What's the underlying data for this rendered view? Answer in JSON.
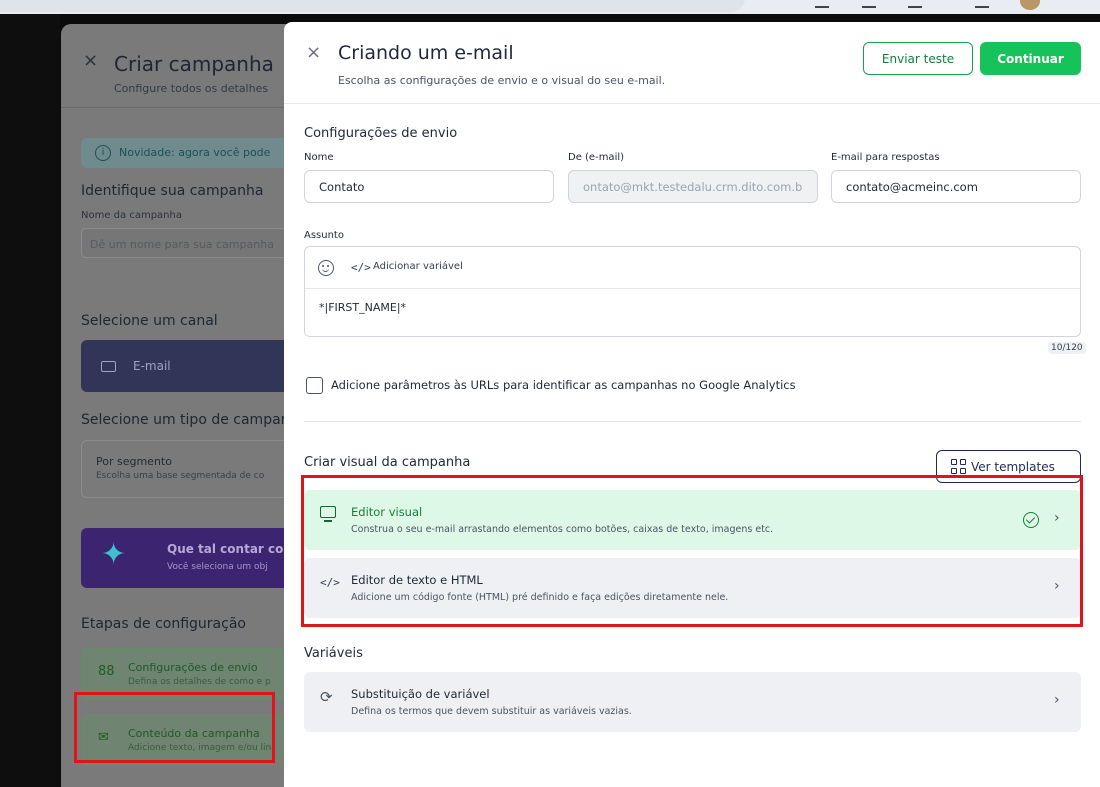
{
  "browser": {
    "url_fragment": "pag"
  },
  "background": {
    "title": "Criar campanha",
    "subtitle": "Configure todos os detalhes",
    "info_banner": "Novidade: agora você pode",
    "identify_heading": "Identifique sua campanha",
    "campaign_name_label": "Nome da campanha",
    "campaign_name_placeholder": "Dê um nome para sua campanha",
    "channel_heading": "Selecione um canal",
    "channel_email": "E-mail",
    "type_heading": "Selecione um tipo de campanha",
    "segment_title": "Por segmento",
    "segment_subtitle": "Escolha uma base segmentada de co",
    "promo_title": "Que tal contar com",
    "promo_subtitle": "Você seleciona um obj",
    "steps_heading": "Etapas de configuração",
    "step1_title": "Configurações de envio",
    "step1_subtitle": "Defina os detalhes de como e p",
    "step2_title": "Conteúdo da campanha",
    "step2_subtitle": "Adicione texto, imagem e/ou lin"
  },
  "drawer": {
    "title": "Criando um e-mail",
    "subtitle": "Escolha as configurações de envio e o visual do seu e-mail.",
    "send_test_label": "Enviar teste",
    "continue_label": "Continuar",
    "send_settings_heading": "Configurações de envio",
    "name_label": "Nome",
    "name_value": "Contato",
    "from_label": "De (e-mail)",
    "from_value": "ontato@mkt.testedalu.crm.dito.com.b",
    "reply_label": "E-mail para respostas",
    "reply_value": "contato@acmeinc.com",
    "subject_label": "Assunto",
    "add_variable_label": "Adicionar variável",
    "subject_value": "*|FIRST_NAME|*",
    "char_counter": "10/120",
    "utm_checkbox_label": "Adicione parâmetros às URLs para identificar as campanhas no Google Analytics",
    "utm_checked": false,
    "visual_heading": "Criar visual da campanha",
    "templates_label": "Ver templates",
    "editor_visual_title": "Editor visual",
    "editor_visual_subtitle": "Construa o seu e-mail arrastando elementos como botões, caixas de texto, imagens etc.",
    "editor_html_title": "Editor de texto e HTML",
    "editor_html_subtitle": "Adicione um código fonte (HTML) pré definido e faça edições diretamente nele.",
    "variables_heading": "Variáveis",
    "var_sub_title": "Substituição de variável",
    "var_sub_subtitle": "Defina os termos que devem substituir as variáveis vazias."
  },
  "icons": {
    "close": "×",
    "chevron": "›",
    "code": "</>",
    "refresh": "⟳",
    "sparkle": "✦",
    "steps": "88"
  },
  "colors": {
    "accent_green": "#16c25a",
    "selected_bg": "#def8e7",
    "highlight_red": "#e0151b",
    "navy": "#1e2a5a"
  }
}
